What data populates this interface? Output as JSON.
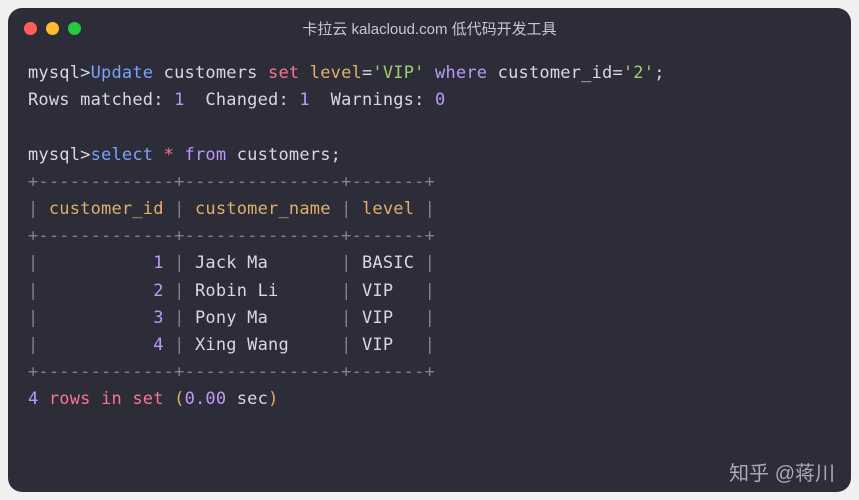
{
  "title": "卡拉云 kalacloud.com 低代码开发工具",
  "prompt": "mysql>",
  "query1": {
    "update": "Update",
    "table": "customers",
    "set": "set",
    "col1": "level",
    "eq": "=",
    "val1": "'VIP'",
    "where": "where",
    "col2": "customer_id",
    "val2": "'2'",
    "semi": ";"
  },
  "result1": {
    "matched_label": "Rows matched:",
    "matched_val": "1",
    "changed_label": "Changed:",
    "changed_val": "1",
    "warnings_label": "Warnings:",
    "warnings_val": "0"
  },
  "query2": {
    "select": "select",
    "star": "*",
    "from": "from",
    "table": "customers",
    "semi": ";"
  },
  "table": {
    "border": "+-------------+---------------+-------+",
    "headers": {
      "h1": "customer_id",
      "h2": "customer_name",
      "h3": "level"
    },
    "rows": [
      {
        "id": "1",
        "name": "Jack Ma",
        "level": "BASIC"
      },
      {
        "id": "2",
        "name": "Robin Li",
        "level": "VIP"
      },
      {
        "id": "3",
        "name": "Pony Ma",
        "level": "VIP"
      },
      {
        "id": "4",
        "name": "Xing Wang",
        "level": "VIP"
      }
    ]
  },
  "summary": {
    "count": "4",
    "text1": "rows",
    "text2": "in",
    "text3": "set",
    "paren_open": "(",
    "time": "0.00",
    "sec": "sec",
    "paren_close": ")"
  },
  "watermark": "知乎 @蒋川"
}
